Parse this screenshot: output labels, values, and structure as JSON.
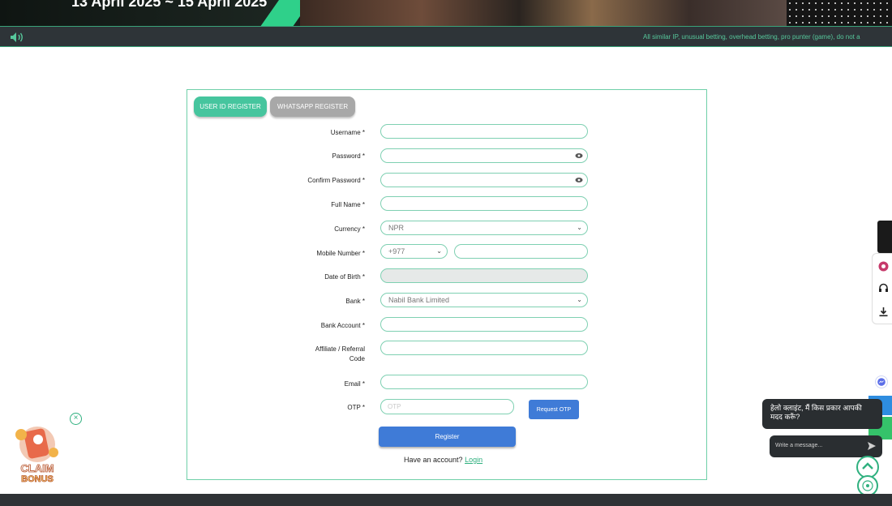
{
  "banner": {
    "date_text": "13 April 2025 ~ 15 April 2025"
  },
  "announcement": {
    "icon": "speaker-icon",
    "text": "All similar IP, unusual betting, overhead betting, pro punter (game), do not a"
  },
  "tabs": [
    {
      "label": "USER ID REGISTER",
      "active": true
    },
    {
      "label": "WHATSAPP REGISTER",
      "active": false
    }
  ],
  "form": {
    "username_label": "Username *",
    "password_label": "Password *",
    "confirm_password_label": "Confirm Password *",
    "full_name_label": "Full Name *",
    "currency_label": "Currency *",
    "currency_value": "NPR",
    "mobile_label": "Mobile Number *",
    "mobile_code": "+977",
    "dob_label": "Date of Birth *",
    "bank_label": "Bank *",
    "bank_value": "Nabil Bank Limited",
    "bank_account_label": "Bank Account *",
    "affiliate_label_line1": "Affiliate / Referral",
    "affiliate_label_line2": "Code",
    "email_label": "Email *",
    "otp_label": "OTP *",
    "otp_placeholder": "OTP",
    "request_otp": "Request OTP",
    "register": "Register",
    "have_account": "Have an account?",
    "login": "Login"
  },
  "chat": {
    "greeting": "हेलो क्लाइंट, मैं किस प्रकार आपकी मदद करूँ?",
    "input_placeholder": "Write a message..."
  },
  "colors": {
    "accent": "#46c59e",
    "button_blue": "#3f7bd7",
    "border": "#7fd0b2"
  }
}
